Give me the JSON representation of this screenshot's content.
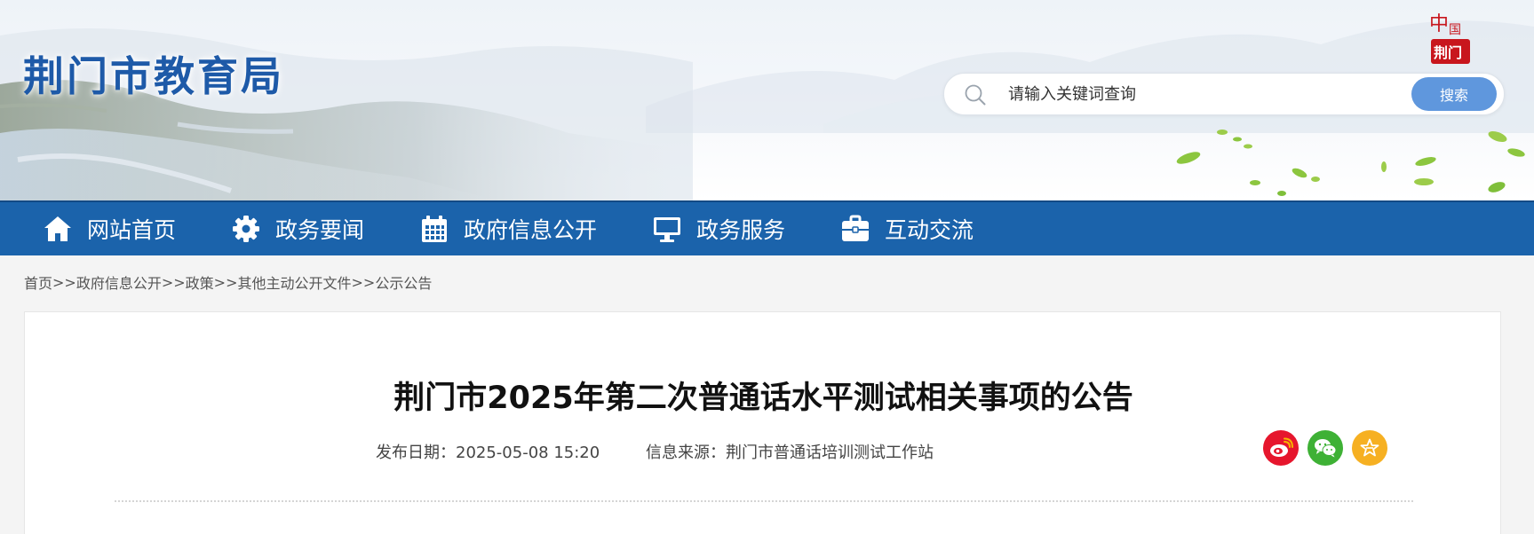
{
  "header": {
    "site_title": "荆门市教育局",
    "badge_top": "中国",
    "badge_bottom": "荆门",
    "search": {
      "placeholder": "请输入关键词查询",
      "button_label": "搜索"
    }
  },
  "nav": {
    "items": [
      {
        "label": "网站首页",
        "icon": "home-icon"
      },
      {
        "label": "政务要闻",
        "icon": "gear-icon"
      },
      {
        "label": "政府信息公开",
        "icon": "calendar-icon"
      },
      {
        "label": "政务服务",
        "icon": "monitor-icon"
      },
      {
        "label": "互动交流",
        "icon": "briefcase-icon"
      }
    ]
  },
  "breadcrumb": {
    "items": [
      "首页",
      "政府信息公开",
      "政策",
      "其他主动公开文件",
      "公示公告"
    ],
    "separator": ">>"
  },
  "article": {
    "title": "荆门市2025年第二次普通话水平测试相关事项的公告",
    "publish_date_label": "发布日期：",
    "publish_date": "2025-05-08 15:20",
    "source_label": "信息来源：",
    "source": "荆门市普通话培训测试工作站"
  },
  "share": [
    {
      "name": "weibo-icon",
      "color": "#e6162d"
    },
    {
      "name": "wechat-icon",
      "color": "#3eb135"
    },
    {
      "name": "favorite-star-icon",
      "color": "#f6b022"
    }
  ],
  "colors": {
    "brand_blue": "#1e5aa8",
    "nav_blue": "#1b63ab",
    "search_button": "#5f97dd"
  }
}
